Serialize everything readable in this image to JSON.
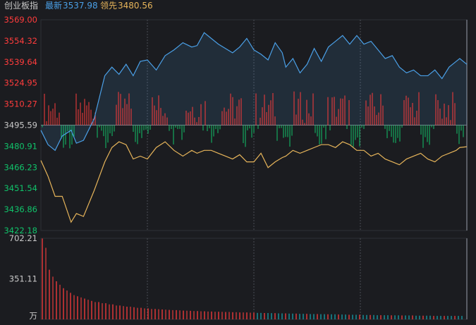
{
  "header": {
    "index_name": "创业板指",
    "latest_label": "最新",
    "latest_value": "3537.98",
    "lead_label": "领先",
    "lead_value": "3480.56"
  },
  "colors": {
    "background": "#1b1c20",
    "up": "#ff3c3c",
    "down": "#10c36a",
    "price_line": "#4a9fe6",
    "lead_line": "#e6b45a",
    "grid": "#2e3036",
    "volume_bar": "#14a0aa"
  },
  "chart_data": [
    {
      "type": "line",
      "name": "intraday-price",
      "prev_close": 3495.59,
      "ylim": [
        3422.18,
        3569.0
      ],
      "y_ticks": [
        {
          "label": "3569.00",
          "value": 3569.0,
          "tone": "up"
        },
        {
          "label": "3554.32",
          "value": 3554.32,
          "tone": "up"
        },
        {
          "label": "3539.64",
          "value": 3539.64,
          "tone": "up"
        },
        {
          "label": "3524.95",
          "value": 3524.95,
          "tone": "up"
        },
        {
          "label": "3510.27",
          "value": 3510.27,
          "tone": "up"
        },
        {
          "label": "3495.59",
          "value": 3495.59,
          "tone": "flat"
        },
        {
          "label": "3480.91",
          "value": 3480.91,
          "tone": "down"
        },
        {
          "label": "3466.23",
          "value": 3466.23,
          "tone": "down"
        },
        {
          "label": "3451.54",
          "value": 3451.54,
          "tone": "down"
        },
        {
          "label": "3436.86",
          "value": 3436.86,
          "tone": "down"
        },
        {
          "label": "3422.18",
          "value": 3422.18,
          "tone": "down"
        }
      ],
      "x_index_max": 240,
      "series": [
        {
          "role": "price",
          "x": [
            0,
            4,
            8,
            12,
            17,
            20,
            24,
            30,
            36,
            40,
            44,
            48,
            52,
            56,
            60,
            65,
            70,
            75,
            80,
            85,
            88,
            92,
            96,
            100,
            104,
            108,
            112,
            116,
            120,
            124,
            128,
            132,
            136,
            138,
            142,
            146,
            150,
            154,
            158,
            162,
            166,
            170,
            174,
            178,
            182,
            186,
            190,
            194,
            198,
            202,
            206,
            210,
            214,
            218,
            222,
            226,
            230,
            234,
            236,
            240
          ],
          "y": [
            3492,
            3482,
            3478,
            3488,
            3492,
            3483,
            3485,
            3500,
            3530,
            3536,
            3531,
            3538,
            3530,
            3540,
            3541,
            3534,
            3544,
            3548,
            3553,
            3550,
            3551,
            3560,
            3556,
            3552,
            3549,
            3546,
            3550,
            3556,
            3548,
            3545,
            3541,
            3553,
            3546,
            3536,
            3542,
            3532,
            3538,
            3549,
            3540,
            3550,
            3554,
            3558,
            3552,
            3558,
            3552,
            3554,
            3548,
            3542,
            3544,
            3536,
            3532,
            3534,
            3530,
            3530,
            3534,
            3528,
            3536,
            3540,
            3542,
            3537.98
          ]
        },
        {
          "role": "lead",
          "x": [
            0,
            4,
            8,
            12,
            17,
            20,
            24,
            30,
            36,
            40,
            44,
            48,
            52,
            56,
            60,
            65,
            70,
            75,
            80,
            85,
            88,
            92,
            96,
            100,
            104,
            108,
            112,
            116,
            120,
            124,
            128,
            132,
            136,
            138,
            142,
            146,
            150,
            154,
            158,
            162,
            166,
            170,
            174,
            178,
            182,
            186,
            190,
            194,
            198,
            202,
            206,
            210,
            214,
            218,
            222,
            226,
            230,
            234,
            236,
            240
          ],
          "y": [
            3471,
            3460,
            3446,
            3446,
            3428,
            3434,
            3432,
            3450,
            3470,
            3480,
            3484,
            3482,
            3472,
            3474,
            3472,
            3480,
            3484,
            3478,
            3474,
            3478,
            3476,
            3478,
            3478,
            3476,
            3474,
            3472,
            3475,
            3470,
            3470,
            3476,
            3466,
            3470,
            3473,
            3474,
            3478,
            3476,
            3478,
            3480,
            3482,
            3482,
            3480,
            3484,
            3482,
            3478,
            3478,
            3474,
            3476,
            3472,
            3470,
            3468,
            3472,
            3474,
            3476,
            3472,
            3470,
            3474,
            3476,
            3478,
            3480,
            3480.56
          ]
        }
      ]
    },
    {
      "type": "bar",
      "name": "volume",
      "unit": "万",
      "y_ticks": [
        {
          "label": "702.21",
          "value": 702.21
        },
        {
          "label": "351.11",
          "value": 351.11
        }
      ],
      "ylim": [
        0,
        702.21
      ],
      "values": [
        700,
        620,
        430,
        370,
        330,
        300,
        270,
        250,
        230,
        210,
        200,
        190,
        180,
        170,
        160,
        150,
        150,
        140,
        140,
        130,
        130,
        120,
        120,
        115,
        110,
        110,
        105,
        100,
        100,
        95,
        95,
        90,
        90,
        88,
        86,
        84,
        82,
        80,
        80,
        78,
        76,
        75,
        74,
        72,
        72,
        70,
        70,
        68,
        68,
        66,
        66,
        65,
        64,
        64,
        62,
        62,
        60,
        60,
        60,
        58,
        58,
        56,
        56,
        55,
        55,
        54,
        54,
        52,
        52,
        52,
        50,
        50,
        50,
        48,
        48,
        48,
        46,
        46,
        46,
        45,
        45,
        44,
        44,
        44,
        42,
        42,
        42,
        40,
        40,
        40,
        40,
        38,
        38,
        38,
        38,
        36,
        36,
        36,
        36,
        35,
        35,
        35,
        34,
        34,
        34,
        34,
        32,
        32,
        32,
        32,
        32,
        30,
        30,
        30,
        30,
        30,
        30,
        30,
        30,
        30
      ],
      "colors_by_bar": "up-down-alternating"
    }
  ]
}
